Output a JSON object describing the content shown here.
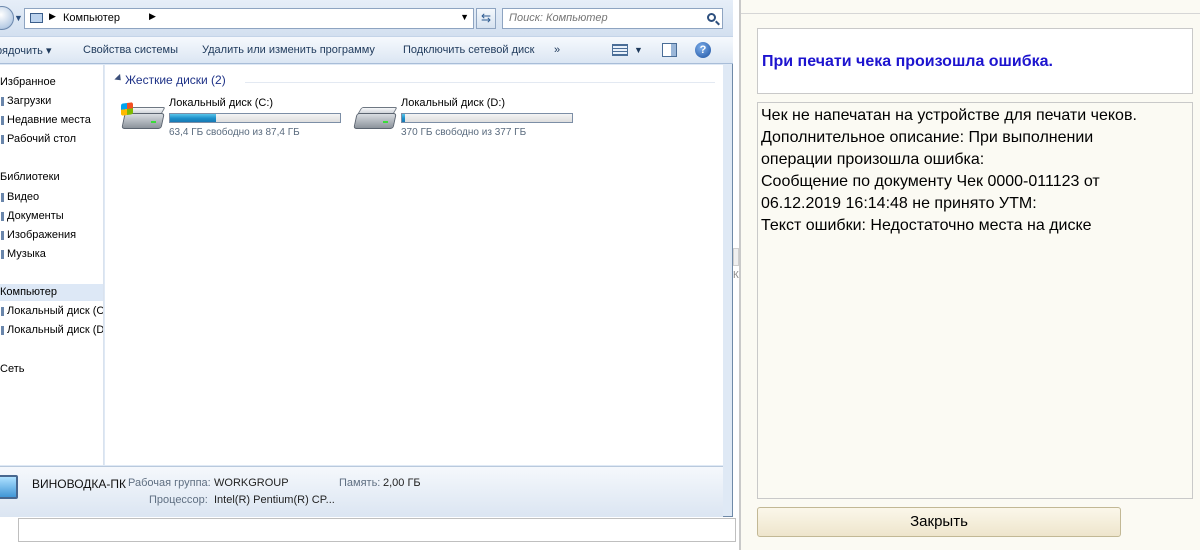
{
  "explorer": {
    "address": {
      "location": "Компьютер"
    },
    "search": {
      "placeholder": "Поиск: Компьютер"
    },
    "toolbar": {
      "organize": "рядочить ▾",
      "system_properties": "Свойства системы",
      "uninstall": "Удалить или изменить программу",
      "map_drive": "Подключить сетевой диск",
      "more": "»"
    },
    "sidebar": {
      "favorites": "Избранное",
      "downloads": "Загрузки",
      "recent": "Недавние места",
      "desktop": "Рабочий стол",
      "libraries": "Библиотеки",
      "video": "Видео",
      "documents": "Документы",
      "pictures": "Изображения",
      "music": "Музыка",
      "computer": "Компьютер",
      "disk_c": "Локальный диск (C",
      "disk_d": "Локальный диск (D",
      "network": "Сеть"
    },
    "content": {
      "group_header": "Жесткие диски (2)",
      "drives": [
        {
          "name": "Локальный диск (C:)",
          "free_text": "63,4 ГБ свободно из 87,4 ГБ",
          "used_fraction": 0.27
        },
        {
          "name": "Локальный диск (D:)",
          "free_text": "370 ГБ свободно из 377 ГБ",
          "used_fraction": 0.02
        }
      ]
    },
    "status": {
      "pc_name": "ВИНОВОДКА-ПК",
      "workgroup_label": "Рабочая группа:",
      "workgroup_value": "WORKGROUP",
      "memory_label": "Память:",
      "memory_value": "2,00 ГБ",
      "cpu_label": "Процессор:",
      "cpu_value": "Intel(R) Pentium(R) CP..."
    }
  },
  "dialog": {
    "title": "При печати чека произошла ошибка.",
    "message_lines": [
      "Чек не напечатан на устройстве для печати чеков.",
      "Дополнительное описание: При выполнении",
      "операции произошла ошибка:",
      "Сообщение по документу Чек 0000-011123 от",
      "06.12.2019 16:14:48 не принято УТМ:",
      "Текст ошибки: Недостаточно места на диске"
    ],
    "close_button": "Закрыть",
    "title_color": "#1d14cf"
  },
  "background": {
    "sliver_text": "К"
  }
}
